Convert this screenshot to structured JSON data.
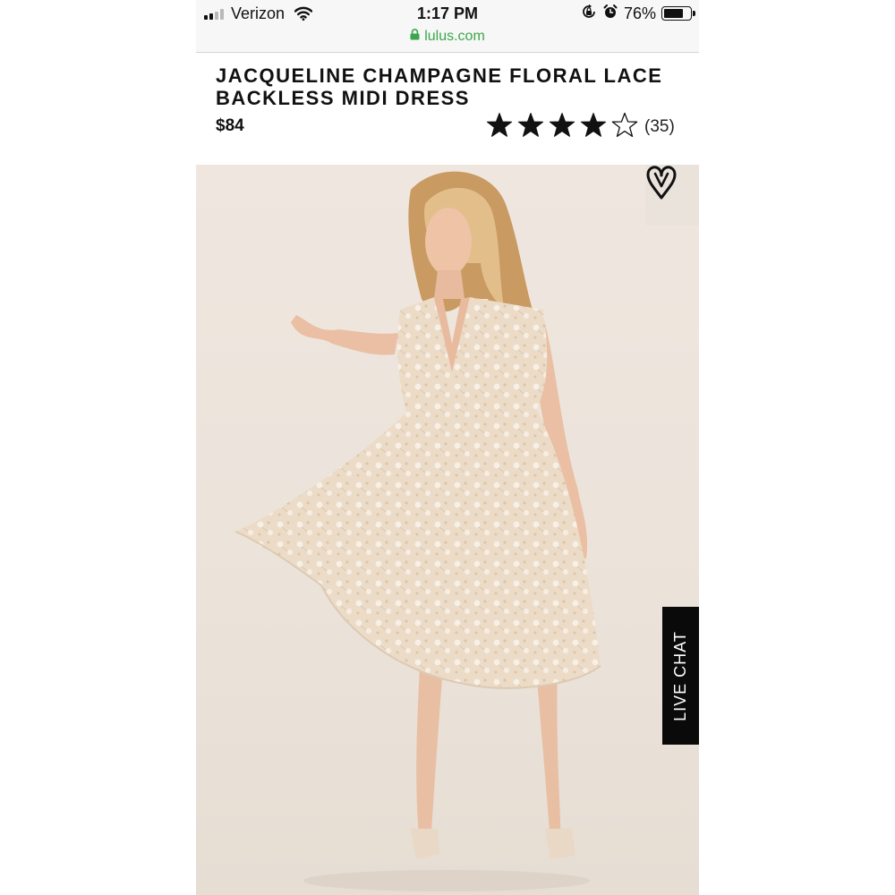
{
  "status_bar": {
    "carrier": "Verizon",
    "time": "1:17 PM",
    "battery_percent": "76%",
    "battery_level": 0.76,
    "signal_bars_filled": 2,
    "signal_bars_total": 4,
    "icons": [
      "signal-icon",
      "wifi-icon",
      "orientation-lock-icon",
      "alarm-icon",
      "battery-icon"
    ]
  },
  "browser": {
    "url": "lulus.com",
    "url_color": "#3aa74a",
    "icons": [
      "lock-icon"
    ]
  },
  "product": {
    "title": "JACQUELINE CHAMPAGNE FLORAL LACE BACKLESS MIDI DRESS",
    "price": "$84",
    "rating": {
      "stars_filled": 4,
      "stars_total": 5,
      "review_count": "(35)"
    }
  },
  "image": {
    "icons": [
      "wishlist-heart-icon"
    ]
  },
  "live_chat": {
    "label": "LIVE CHAT"
  },
  "colors": {
    "text": "#111111",
    "background": "#ffffff",
    "image_backdrop": "#ebe3da",
    "chat_button": "#0a0a0a"
  }
}
